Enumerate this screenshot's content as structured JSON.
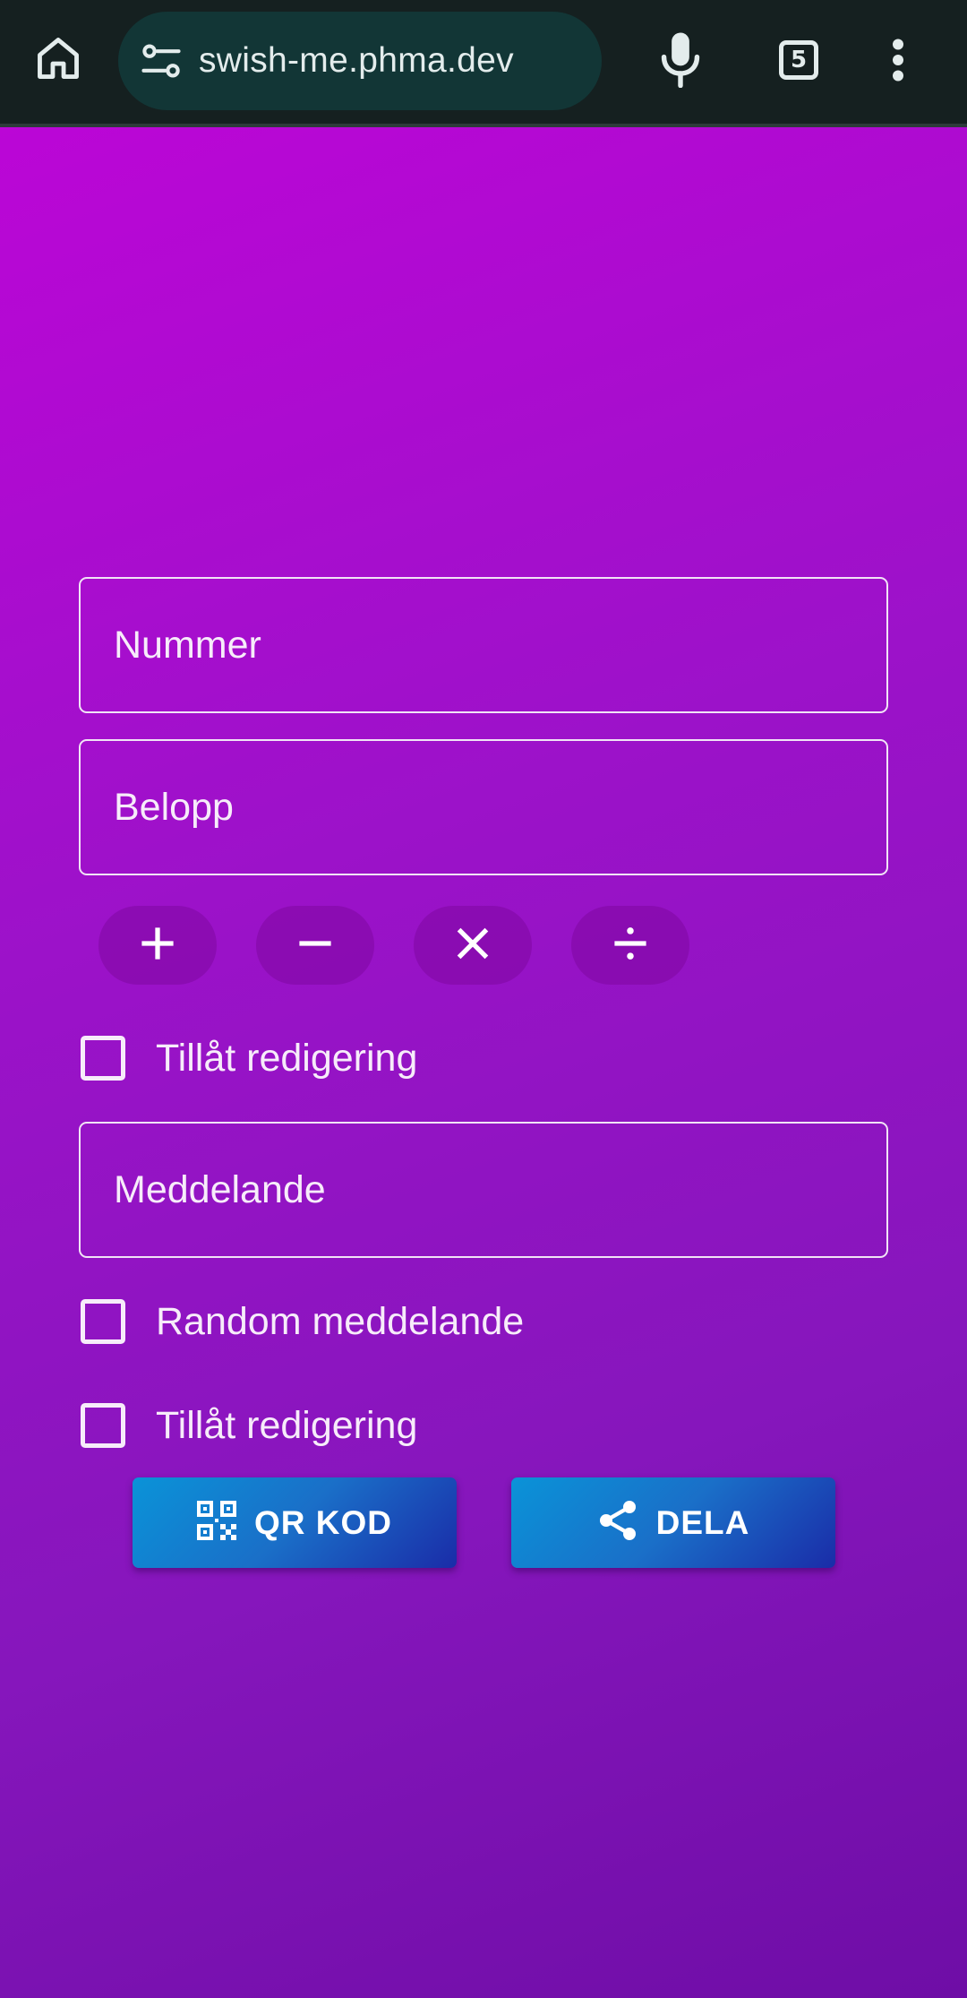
{
  "browser": {
    "url": "swish-me.phma.dev",
    "tab_count": "5",
    "icons": {
      "home": "home-icon",
      "site_settings": "tune-icon",
      "voice": "mic-icon",
      "menu": "more-vert-icon"
    }
  },
  "form": {
    "number_label": "Nummer",
    "amount_label": "Belopp",
    "operators": [
      "+",
      "−",
      "×",
      "÷"
    ],
    "edit_amount_label": "Tillåt redigering",
    "message_label": "Meddelande",
    "random_message_label": "Random meddelande",
    "edit_message_label": "Tillåt redigering",
    "checkboxes": {
      "edit_amount_checked": false,
      "random_message_checked": false,
      "edit_message_checked": false
    }
  },
  "actions": {
    "qr_label": "QR KOD",
    "share_label": "DELA",
    "qr_icon": "qr-code-icon",
    "share_icon": "share-icon"
  },
  "colors": {
    "chrome_bg": "#152020",
    "url_pill": "#123636",
    "page_gradient_start": "#bb06d6",
    "page_gradient_end": "#6e0da6",
    "button_start": "#0a93d8",
    "button_end": "#1a2ca8"
  }
}
